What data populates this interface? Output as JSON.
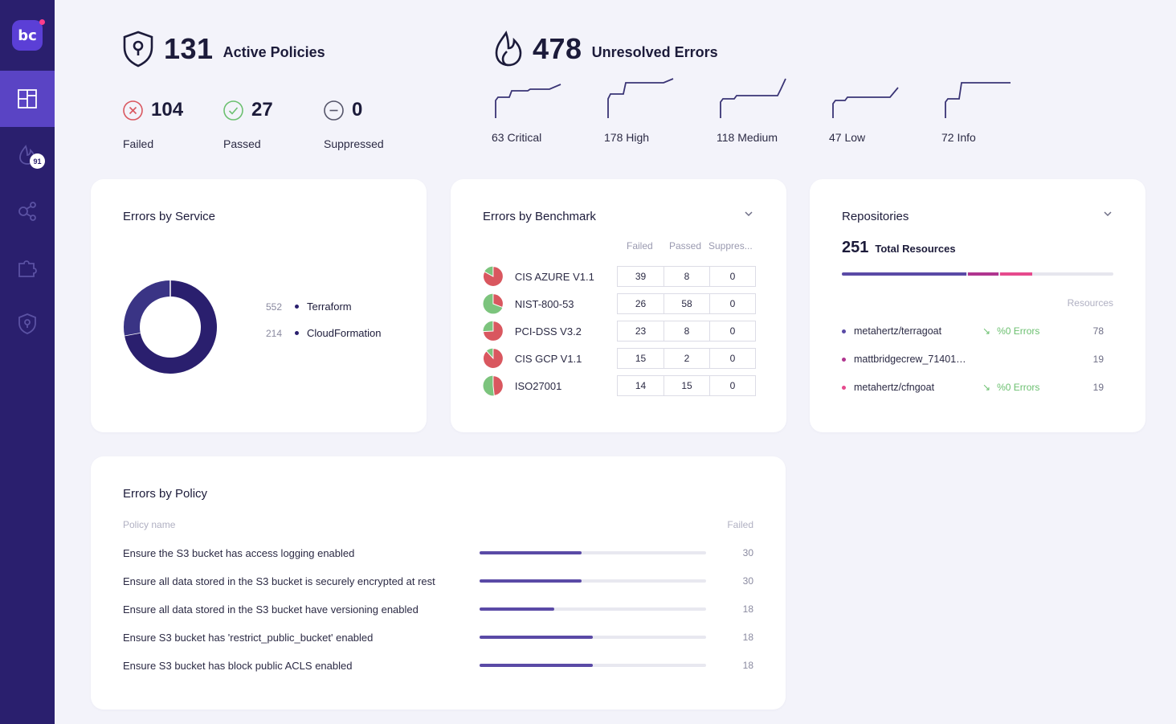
{
  "app": {
    "logo_text": "bc"
  },
  "sidebar": {
    "items": [
      {
        "icon": "dashboard-icon",
        "active": true
      },
      {
        "icon": "flame-icon",
        "badge": "91"
      },
      {
        "icon": "graph-nodes-icon"
      },
      {
        "icon": "puzzle-icon"
      },
      {
        "icon": "shield-keyhole-icon"
      }
    ]
  },
  "policies": {
    "count": "131",
    "label": "Active Policies",
    "failed": {
      "value": "104",
      "label": "Failed"
    },
    "passed": {
      "value": "27",
      "label": "Passed"
    },
    "suppressed": {
      "value": "0",
      "label": "Suppressed"
    }
  },
  "errors": {
    "count": "478",
    "label": "Unresolved Errors",
    "severity": [
      {
        "label": "63 Critical"
      },
      {
        "label": "178 High"
      },
      {
        "label": "118 Medium"
      },
      {
        "label": "47 Low"
      },
      {
        "label": "72 Info"
      }
    ]
  },
  "errors_by_service": {
    "title": "Errors by Service",
    "items": [
      {
        "value": "552",
        "name": "Terraform"
      },
      {
        "value": "214",
        "name": "CloudFormation"
      }
    ],
    "colors": [
      "#2a1f6e",
      "#3a3485"
    ]
  },
  "errors_by_benchmark": {
    "title": "Errors by Benchmark",
    "columns": [
      "Failed",
      "Passed",
      "Suppres..."
    ],
    "rows": [
      {
        "name": "CIS AZURE V1.1",
        "failed": "39",
        "passed": "8",
        "suppressed": "0"
      },
      {
        "name": "NIST-800-53",
        "failed": "26",
        "passed": "58",
        "suppressed": "0"
      },
      {
        "name": "PCI-DSS V3.2",
        "failed": "23",
        "passed": "8",
        "suppressed": "0"
      },
      {
        "name": "CIS GCP V1.1",
        "failed": "15",
        "passed": "2",
        "suppressed": "0"
      },
      {
        "name": "ISO27001",
        "failed": "14",
        "passed": "15",
        "suppressed": "0"
      }
    ],
    "colors": {
      "failed": "#d9575f",
      "passed": "#7cc47d"
    }
  },
  "repositories": {
    "title": "Repositories",
    "total": "251",
    "total_label": "Total Resources",
    "resources_header": "Resources",
    "segments": [
      {
        "share": 0.46,
        "color": "#5a4aa6"
      },
      {
        "share": 0.11,
        "color": "#b0358f"
      },
      {
        "share": 0.12,
        "color": "#e64a8d"
      }
    ],
    "items": [
      {
        "name": "metahertz/terragoat",
        "trend": "%0 Errors",
        "count": "78",
        "color": "#5a4aa6",
        "show_trend": true
      },
      {
        "name": "mattbridgecrew_714018233...",
        "trend": "",
        "count": "19",
        "color": "#b0358f",
        "show_trend": false
      },
      {
        "name": "metahertz/cfngoat",
        "trend": "%0 Errors",
        "count": "19",
        "color": "#e64a8d",
        "show_trend": true
      }
    ]
  },
  "errors_by_policy": {
    "title": "Errors by Policy",
    "name_header": "Policy name",
    "failed_header": "Failed",
    "rows": [
      {
        "name": "Ensure the S3 bucket has access logging enabled",
        "failed": "30",
        "fill": 0.45
      },
      {
        "name": "Ensure all data stored in the S3 bucket is securely encrypted at rest",
        "failed": "30",
        "fill": 0.45
      },
      {
        "name": "Ensure all data stored in the S3 bucket have versioning enabled",
        "failed": "18",
        "fill": 0.33
      },
      {
        "name": "Ensure S3 bucket has 'restrict_public_bucket' enabled",
        "failed": "18",
        "fill": 0.5
      },
      {
        "name": "Ensure S3 bucket has block public ACLS enabled",
        "failed": "18",
        "fill": 0.5
      }
    ]
  }
}
